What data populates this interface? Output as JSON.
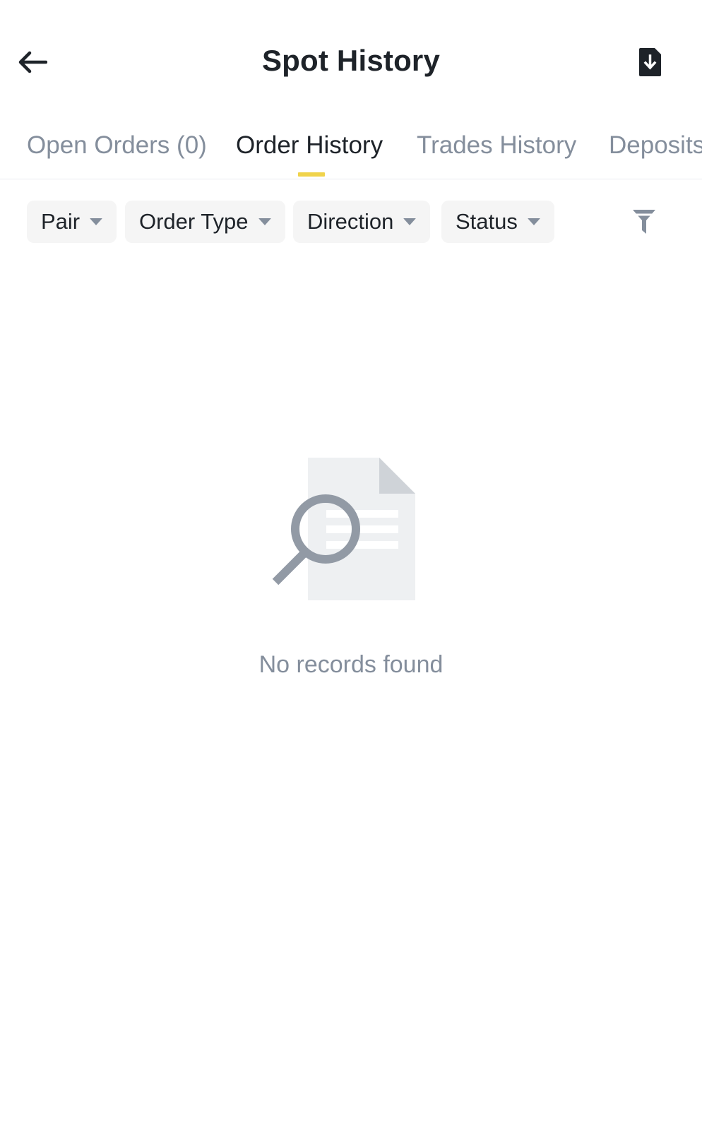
{
  "header": {
    "title": "Spot History",
    "back_icon": "arrow-left-icon",
    "export_icon": "download-document-icon"
  },
  "tabs": [
    {
      "label": "Open Orders (0)",
      "active": false
    },
    {
      "label": "Order History",
      "active": true
    },
    {
      "label": "Trades History",
      "active": false
    },
    {
      "label": "Deposits",
      "active": false
    }
  ],
  "filters": {
    "chips": [
      {
        "label": "Pair"
      },
      {
        "label": "Order Type"
      },
      {
        "label": "Direction"
      },
      {
        "label": "Status"
      }
    ],
    "filter_icon": "funnel-icon"
  },
  "empty_state": {
    "icon": "document-search-icon",
    "message": "No records found"
  },
  "colors": {
    "text_primary": "#1e2329",
    "text_secondary": "#848e9c",
    "accent": "#f0d34b",
    "chip_background": "#f5f5f5"
  }
}
